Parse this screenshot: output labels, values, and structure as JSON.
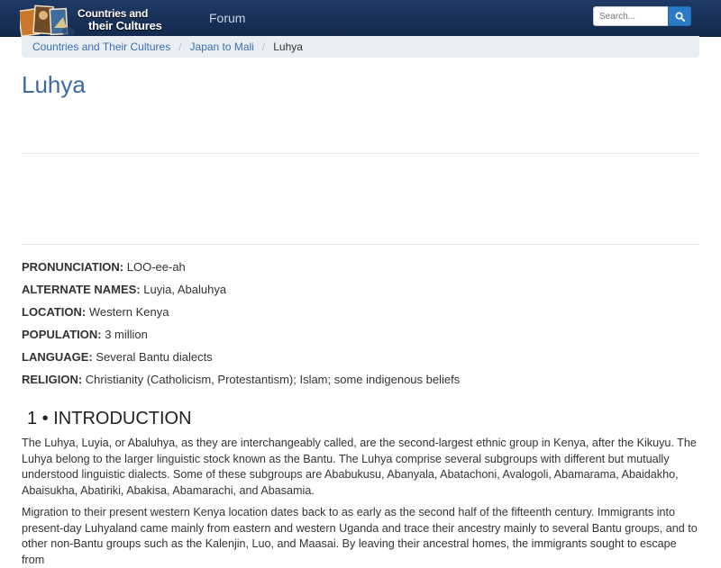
{
  "header": {
    "logo_line1": "Countries and",
    "logo_line2": "their Cultures",
    "nav_forum": "Forum",
    "search_placeholder": "Search..."
  },
  "breadcrumb": {
    "item1": "Countries and Their Cultures",
    "item2": "Japan to Mali",
    "current": "Luhya"
  },
  "page_title": "Luhya",
  "facts": [
    {
      "label": "PRONUNCIATION:",
      "value": " LOO-ee-ah"
    },
    {
      "label": "ALTERNATE NAMES:",
      "value": " Luyia, Abaluhya"
    },
    {
      "label": "LOCATION:",
      "value": " Western Kenya"
    },
    {
      "label": "POPULATION:",
      "value": " 3 million"
    },
    {
      "label": "LANGUAGE:",
      "value": " Several Bantu dialects"
    },
    {
      "label": "RELIGION:",
      "value": " Christianity (Catholicism, Protestantism); Islam; some indigenous beliefs"
    }
  ],
  "section1": {
    "heading": "1 • INTRODUCTION",
    "p1": "The Luhya, Luyia, or Abaluhya, as they are interchangeably called, are the second-largest ethnic group in Kenya, after the Kikuyu. The Luhya belong to the larger linguistic stock known as the Bantu. The Luhya comprise several subgroups with different but mutually understood linguistic dialects. Some of these subgroups are Ababukusu, Abanyala, Abatachoni, Avalogoli, Abamarama, Abaidakho, Abaisukha, Abatiriki, Abakisa, Abamarachi, and Abasamia.",
    "p2": "Migration to their present western Kenya location dates back to as early as the second half of the fifteenth century. Immigrants into present-day Luhyaland came mainly from eastern and western Uganda and trace their ancestry mainly to several Bantu groups, and to other non-Bantu groups such as the Kalenjin, Luo, and Maasai. By leaving their ancestral homes, the immigrants sought to escape from"
  },
  "colors": {
    "navbar": "#1f3a66",
    "link": "#3b6fb0",
    "title": "#3d6aa6",
    "search_button": "#2a7ac8",
    "breadcrumb_bg": "#e9eef5"
  }
}
